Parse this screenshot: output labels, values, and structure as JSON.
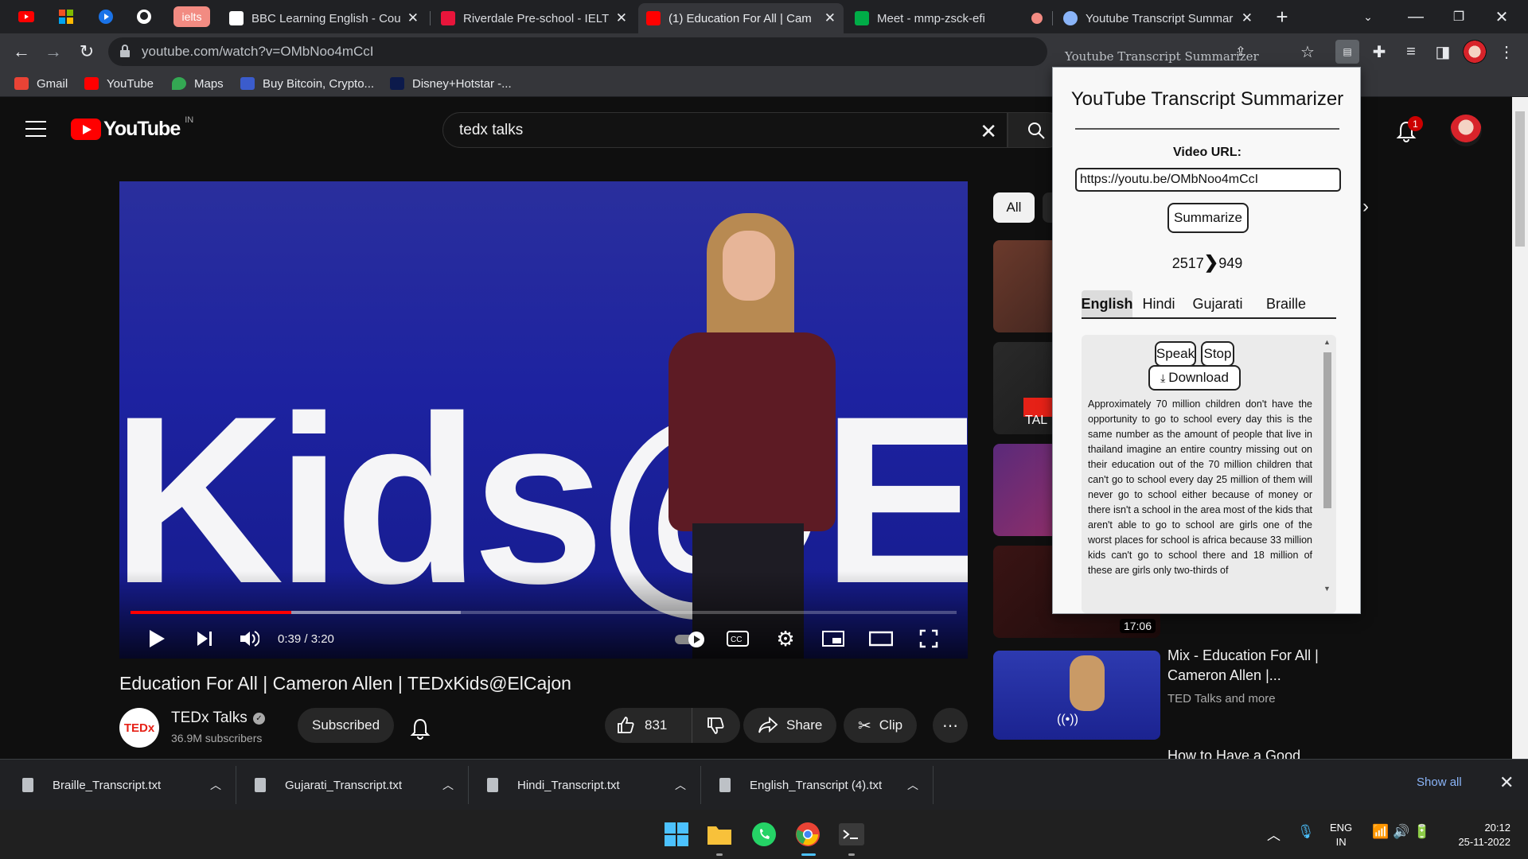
{
  "browser": {
    "pinned_tabs": [
      "youtube-favicon",
      "microsoft-favicon",
      "play-favicon",
      "github-favicon",
      "ielts-tab"
    ],
    "pinned_ielts_label": "ielts",
    "tabs": [
      {
        "title": "BBC Learning English - Cou",
        "close": "✕"
      },
      {
        "title": "Riverdale Pre-school - IELTS",
        "close": "✕"
      },
      {
        "title": "(1) Education For All | Cam",
        "close": "✕"
      },
      {
        "title": "Meet - mmp-zsck-efi",
        "close": ""
      },
      {
        "title": "Youtube Transcript Summar",
        "close": "✕"
      }
    ],
    "new_tab": "+",
    "url": "youtube.com/watch?v=OMbNoo4mCcI",
    "bookmarks": [
      {
        "label": "Gmail",
        "color": "#ea4335"
      },
      {
        "label": "YouTube",
        "color": "#ff0000"
      },
      {
        "label": "Maps",
        "color": "#34a853"
      },
      {
        "label": "Buy Bitcoin, Crypto...",
        "color": "#3b5ccc"
      },
      {
        "label": "Disney+Hotstar -...",
        "color": "#0c1a4b"
      }
    ]
  },
  "youtube": {
    "logo_text": "YouTube",
    "country": "IN",
    "search_query": "tedx talks",
    "search_clear": "✕",
    "notification_count": "1",
    "player": {
      "stage_text": "Kids@E",
      "current_time": "0:39",
      "duration": "3:20",
      "time_display": "0:39 / 3:20",
      "progress": 0.195
    },
    "video_title": "Education For All | Cameron Allen | TEDxKids@ElCajon",
    "channel": {
      "logo_text": "TEDx",
      "name": "TEDx Talks",
      "subscribers": "36.9M subscribers",
      "verified": "✓"
    },
    "actions": {
      "subscribed": "Subscribed",
      "likes": "831",
      "share": "Share",
      "clip": "Clip",
      "more": "⋯"
    },
    "sidebar": {
      "chip_all": "All",
      "thumb_partial_text": "TAL",
      "duration_badge": "17:06",
      "mix_title": "Mix - Education For All | Cameron Allen |...",
      "mix_sub": "TED Talks and more",
      "next_title": "How to Have a Good"
    }
  },
  "extension": {
    "toolbar_label": "Youtube Transcript Summarizer",
    "title": "YouTube Transcript Summarizer",
    "url_label": "Video URL:",
    "url_value": "https://youtu.be/OMbNoo4mCcI",
    "summarize": "Summarize",
    "count_from": "2517",
    "count_to": "949",
    "languages": [
      "English",
      "Hindi",
      "Gujarati",
      "Braille"
    ],
    "active_language": "English",
    "speak": "Speak",
    "stop": "Stop",
    "download": "Download",
    "transcript": "Approximately 70 million children don't have the opportunity to go to school every day this is the same number as the amount of people that live in thailand imagine an entire country missing out on their education out of the 70 million children that can't go to school every day 25 million of them will never go to school either because of money or there isn't a school in the area most of the kids that aren't able to go to school are girls one of the worst places for school is africa because 33 million kids can't go to school there and 18 million of these are girls only two-thirds of"
  },
  "downloads": {
    "items": [
      "Braille_Transcript.txt",
      "Gujarati_Transcript.txt",
      "Hindi_Transcript.txt",
      "English_Transcript (4).txt"
    ],
    "show_all": "Show all",
    "close": "✕"
  },
  "taskbar": {
    "apps": [
      "windows-start",
      "file-explorer",
      "whatsapp",
      "chrome",
      "terminal"
    ],
    "lang_line1": "ENG",
    "lang_line2": "IN",
    "time": "20:12",
    "date": "25-11-2022"
  }
}
